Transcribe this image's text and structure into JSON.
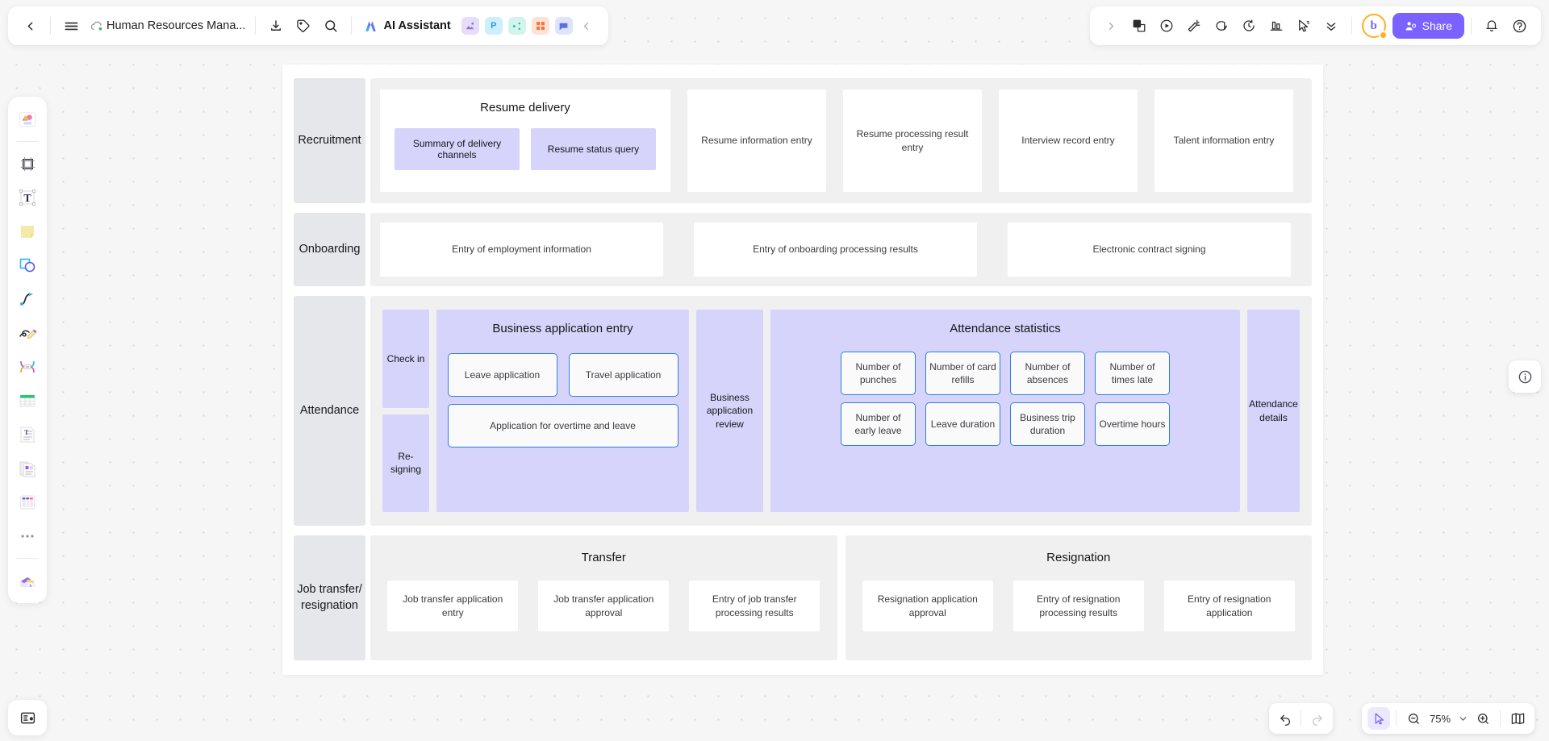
{
  "topbar": {
    "back_icon": "chevron-left-icon",
    "menu_icon": "hamburger-menu-icon",
    "cloud_icon": "cloud-sync-icon",
    "doc_title": "Human Resources Mana...",
    "download_icon": "download-icon",
    "tag_icon": "tag-icon",
    "search_icon": "search-icon",
    "ai_assistant_label": "AI Assistant",
    "app_icons": [
      {
        "name": "image-app-icon",
        "glyph": "◰",
        "bg": "#e7ddfb",
        "fg": "#8f6ff0"
      },
      {
        "name": "presentation-app-icon",
        "glyph": "P",
        "bg": "#cdeefb",
        "fg": "#2a9fd6"
      },
      {
        "name": "mindmap-app-icon",
        "glyph": "✦",
        "bg": "#d3f4ec",
        "fg": "#21b894"
      },
      {
        "name": "grid-app-icon",
        "glyph": "▦",
        "bg": "#fde2d6",
        "fg": "#f07a3c"
      },
      {
        "name": "chat-app-icon",
        "glyph": "▭",
        "bg": "#dfe4fc",
        "fg": "#5a6fe0"
      }
    ],
    "collapse_icon": "chevron-left-collapse-icon",
    "right_expand_icon": "chevron-right-icon",
    "right_icons": [
      {
        "name": "template-icon"
      },
      {
        "name": "play-circle-icon"
      },
      {
        "name": "announce-icon"
      },
      {
        "name": "comment-icon"
      },
      {
        "name": "history-icon"
      },
      {
        "name": "stats-icon"
      },
      {
        "name": "cursor-share-icon"
      },
      {
        "name": "chevron-double-down-icon"
      }
    ],
    "avatar_letter": "b",
    "share_label": "Share",
    "share_color": "#7b61ff",
    "bell_icon": "notification-bell-icon",
    "help_icon": "help-circle-icon"
  },
  "left_rail": {
    "items": [
      {
        "name": "shapes-library-tool"
      },
      {
        "name": "frame-tool"
      },
      {
        "name": "text-tool"
      },
      {
        "name": "sticky-note-tool"
      },
      {
        "name": "shape-tool"
      },
      {
        "name": "connector-tool"
      },
      {
        "name": "pen-tool"
      },
      {
        "name": "mindmap-tool"
      },
      {
        "name": "table-tool"
      },
      {
        "name": "text-block-tool"
      },
      {
        "name": "document-tool"
      },
      {
        "name": "kanban-tool"
      },
      {
        "name": "more-tools"
      },
      {
        "name": "ai-generate-tool"
      }
    ],
    "bottom_item": {
      "name": "presentation-mode-tool"
    }
  },
  "canvas_float": {
    "info_icon": "info-circle-icon"
  },
  "bottom_bar": {
    "undo_icon": "undo-icon",
    "redo_icon": "redo-icon",
    "cursor_icon": "cursor-select-icon",
    "zoom_out_icon": "zoom-out-icon",
    "zoom_level": "75%",
    "zoom_dropdown_icon": "chevron-down-icon",
    "zoom_in_icon": "zoom-in-icon",
    "minimap_icon": "minimap-icon"
  },
  "diagram": {
    "rows": [
      {
        "label": "Recruitment",
        "groups": [
          {
            "type": "titled",
            "title": "Resume delivery",
            "chips": [
              "Summary of delivery channels",
              "Resume status query"
            ]
          },
          {
            "type": "card",
            "label": "Resume information entry"
          },
          {
            "type": "card",
            "label": "Resume processing result entry"
          },
          {
            "type": "card",
            "label": "Interview record entry"
          },
          {
            "type": "card",
            "label": "Talent information entry"
          }
        ]
      },
      {
        "label": "Onboarding",
        "groups": [
          {
            "type": "card",
            "label": "Entry of employment information"
          },
          {
            "type": "card",
            "label": "Entry of onboarding processing results"
          },
          {
            "type": "card",
            "label": "Electronic contract signing"
          }
        ]
      },
      {
        "label": "Attendance",
        "stack": [
          "Check in",
          "Re-signing"
        ],
        "business": {
          "title": "Business application entry",
          "top": [
            "Leave application",
            "Travel application"
          ],
          "wide": "Application for overtime and leave"
        },
        "review_col": "Business application review",
        "statistics": {
          "title": "Attendance statistics",
          "row1": [
            "Number of punches",
            "Number of card refills",
            "Number of absences",
            "Number of times late"
          ],
          "row2": [
            "Number of early leave",
            "Leave duration",
            "Business trip duration",
            "Overtime hours"
          ]
        },
        "details_col": "Attendance details"
      },
      {
        "label": "Job transfer/ resignation",
        "panels": [
          {
            "title": "Transfer",
            "cards": [
              "Job transfer application entry",
              "Job transfer application approval",
              "Entry of job transfer processing results"
            ]
          },
          {
            "title": "Resignation",
            "cards": [
              "Resignation application approval",
              "Entry of resignation processing results",
              "Entry of resignation application"
            ]
          }
        ]
      }
    ]
  },
  "colors": {
    "accent": "#7b61ff",
    "lavender": "#d6d4fb",
    "blue_border": "#2f7fe0",
    "row_label_bg": "#e6e7eb",
    "row_body_bg": "#f0f0f1"
  }
}
